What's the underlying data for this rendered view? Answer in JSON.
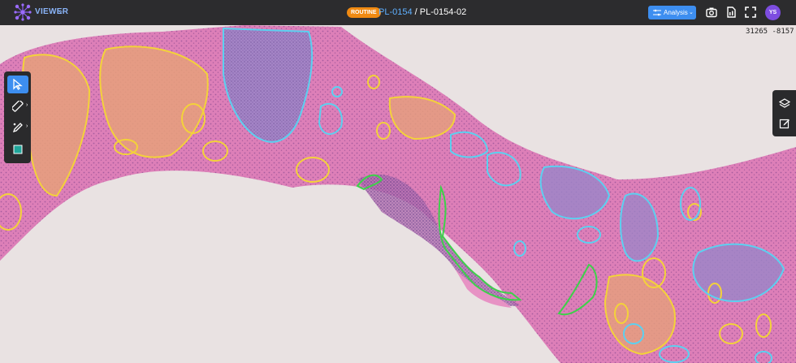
{
  "app": {
    "name": "VIEWER",
    "logo_icon": "network-logo-icon"
  },
  "header": {
    "badge": "ROUTINE",
    "case_id": "PL-0154",
    "separator": " / ",
    "slide_id": "PL-0154-02",
    "analysis_button": "Analysis",
    "user_initials": "YS"
  },
  "viewport": {
    "coordinates": "31265 -8157"
  },
  "colors": {
    "topbar": "#2c2c2e",
    "accent": "#3d8ef0",
    "badge": "#f08a12",
    "avatar": "#7d4de0",
    "annotation_yellow": "#f3d23a",
    "annotation_cyan": "#5cd0f0",
    "annotation_green": "#3dd14a"
  },
  "left_toolbar": [
    "cursor-icon",
    "ruler-icon",
    "annotate-pen-icon",
    "color-swatch-icon"
  ],
  "right_toolbar": [
    "layers-icon",
    "edit-icon"
  ]
}
